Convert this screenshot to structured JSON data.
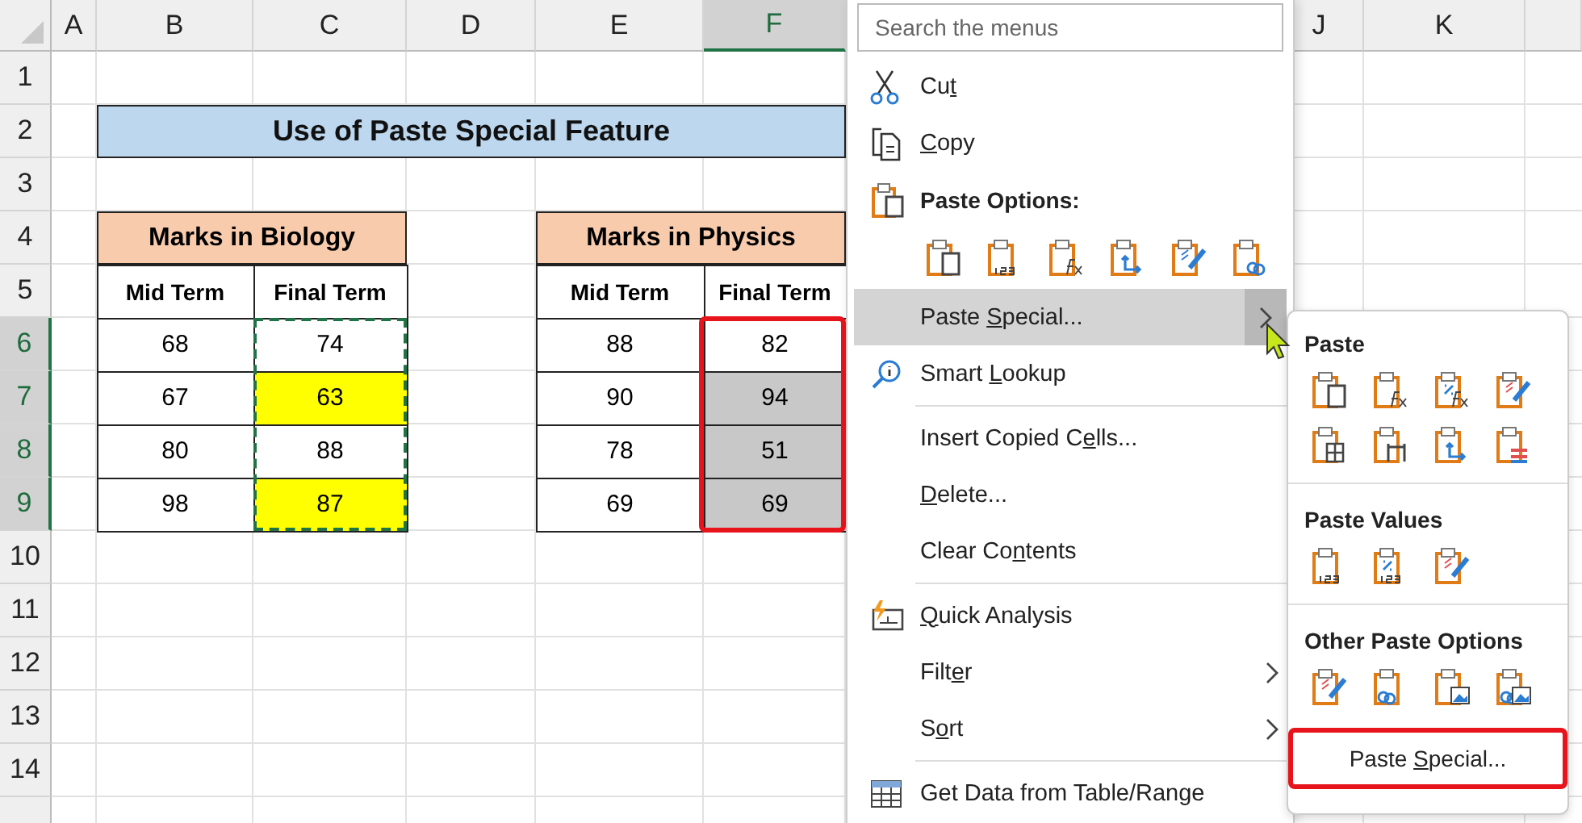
{
  "sheet": {
    "columns": [
      {
        "label": "A",
        "selected": false
      },
      {
        "label": "B",
        "selected": false
      },
      {
        "label": "C",
        "selected": false
      },
      {
        "label": "D",
        "selected": false
      },
      {
        "label": "E",
        "selected": false
      },
      {
        "label": "F",
        "selected": true
      },
      {
        "label": "J",
        "selected": false
      },
      {
        "label": "K",
        "selected": false
      }
    ],
    "rows": [
      {
        "label": "1",
        "selected": false
      },
      {
        "label": "2",
        "selected": false
      },
      {
        "label": "3",
        "selected": false
      },
      {
        "label": "4",
        "selected": false
      },
      {
        "label": "5",
        "selected": false
      },
      {
        "label": "6",
        "selected": true
      },
      {
        "label": "7",
        "selected": true
      },
      {
        "label": "8",
        "selected": true
      },
      {
        "label": "9",
        "selected": true
      },
      {
        "label": "10",
        "selected": false
      },
      {
        "label": "11",
        "selected": false
      },
      {
        "label": "12",
        "selected": false
      },
      {
        "label": "13",
        "selected": false
      },
      {
        "label": "14",
        "selected": false
      }
    ],
    "title": "Use of Paste Special Feature",
    "tables": [
      {
        "title": "Marks in Biology",
        "columns": [
          "Mid Term",
          "Final Term"
        ],
        "copied": true,
        "rows": [
          {
            "mid": "68",
            "final": "74",
            "highlighted": false,
            "selected": false
          },
          {
            "mid": "67",
            "final": "63",
            "highlighted": true,
            "selected": false
          },
          {
            "mid": "80",
            "final": "88",
            "highlighted": false,
            "selected": false
          },
          {
            "mid": "98",
            "final": "87",
            "highlighted": true,
            "selected": false
          }
        ]
      },
      {
        "title": "Marks in Physics",
        "columns": [
          "Mid Term",
          "Final Term"
        ],
        "outlined": true,
        "rows": [
          {
            "mid": "88",
            "final": "82",
            "highlighted": false,
            "selected": false
          },
          {
            "mid": "90",
            "final": "94",
            "highlighted": false,
            "selected": true
          },
          {
            "mid": "78",
            "final": "51",
            "highlighted": false,
            "selected": true
          },
          {
            "mid": "69",
            "final": "69",
            "highlighted": false,
            "selected": true
          }
        ]
      }
    ]
  },
  "context_menu": {
    "search": {
      "placeholder": "Search the menus"
    },
    "items": [
      {
        "kind": "command",
        "label": {
          "before": "Cu",
          "key": "t"
        },
        "submenu": false,
        "hovered": false
      },
      {
        "kind": "command",
        "label": {
          "key": "C",
          "after": "opy"
        },
        "submenu": false,
        "hovered": false
      },
      {
        "kind": "section",
        "label": "Paste Options:"
      },
      {
        "kind": "icon_row"
      },
      {
        "kind": "command",
        "label": {
          "before": "Paste ",
          "key": "S",
          "after": "pecial..."
        },
        "submenu": true,
        "hovered": true
      },
      {
        "kind": "command",
        "label": {
          "before": "Smart ",
          "key": "L",
          "after": "ookup"
        },
        "submenu": false,
        "hovered": false
      },
      {
        "kind": "separator"
      },
      {
        "kind": "command",
        "label": {
          "before": "Insert Copied C",
          "key": "e",
          "after": "lls..."
        },
        "submenu": false,
        "hovered": false
      },
      {
        "kind": "command",
        "label": {
          "key": "D",
          "after": "elete..."
        },
        "submenu": false,
        "hovered": false
      },
      {
        "kind": "command",
        "label": {
          "before": "Clear Co",
          "key": "n",
          "after": "tents"
        },
        "submenu": false,
        "hovered": false
      },
      {
        "kind": "separator"
      },
      {
        "kind": "command",
        "label": {
          "key": "Q",
          "after": "uick Analysis"
        },
        "submenu": false,
        "hovered": false
      },
      {
        "kind": "command",
        "label": {
          "before": "Filt",
          "key": "e",
          "after": "r"
        },
        "submenu": true,
        "hovered": false
      },
      {
        "kind": "command",
        "label": {
          "before": "S",
          "key": "o",
          "after": "rt"
        },
        "submenu": true,
        "hovered": false
      },
      {
        "kind": "separator"
      },
      {
        "kind": "command",
        "label": {
          "before": "Get Data from Table/Range"
        },
        "submenu": false,
        "hovered": false
      }
    ]
  },
  "submenu": {
    "sections": [
      {
        "title": "Paste"
      },
      {
        "title": "Paste Values"
      },
      {
        "title": "Other Paste Options"
      }
    ],
    "button": {
      "label": {
        "before": "Paste ",
        "key": "S",
        "after": "pecial..."
      },
      "outlined": true
    }
  }
}
